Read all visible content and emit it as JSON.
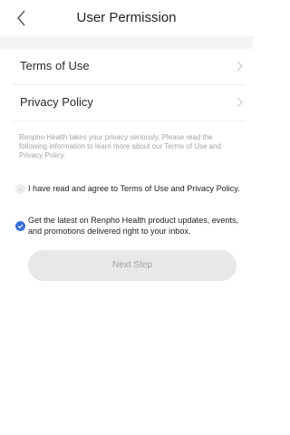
{
  "header": {
    "title": "User Permission",
    "back_icon": "chevron-left-icon"
  },
  "menu": {
    "items": [
      {
        "label": "Terms of Use",
        "icon": "chevron-right-icon"
      },
      {
        "label": "Privacy Policy",
        "icon": "chevron-right-icon"
      }
    ]
  },
  "notice": {
    "text": "Renpho Health takes your privacy seriously. Please read the following information to learn more about our Terms of Use and Privacy Policy."
  },
  "consents": [
    {
      "label": "I have read and agree to Terms of Use and Privacy Policy.",
      "checked": false
    },
    {
      "label": "Get the latest on Renpho Health product updates, events, and promotions delivered right to your inbox.",
      "checked": true
    }
  ],
  "next_button": {
    "label": "Next Step",
    "enabled": false
  },
  "colors": {
    "accent": "#3a6fd8",
    "divider": "#eeeeee",
    "muted_text": "#a3a3a3",
    "button_bg": "#e8e8e8"
  }
}
